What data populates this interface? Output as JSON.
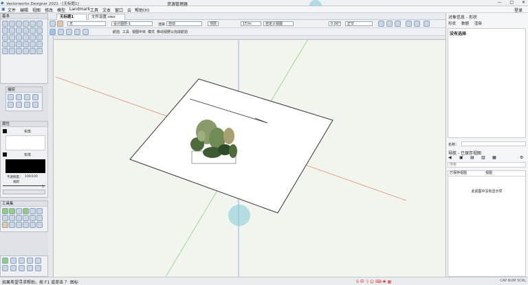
{
  "window": {
    "title": "Vectorworks Designer 2021 - [无标题1]",
    "center_title": "资源管理器",
    "controls": [
      "—",
      "□",
      "✕"
    ]
  },
  "menu": [
    "文件",
    "编辑",
    "视图",
    "修改",
    "模型",
    "Landmark",
    "工具",
    "文本",
    "窗口",
    "云",
    "帮助(H)"
  ],
  "menu_right": "登录",
  "tabs": [
    {
      "label": "无标题1",
      "close": "×"
    },
    {
      "label": "文件设置.vwx",
      "close": "×"
    }
  ],
  "toolbar": {
    "class_value": "无",
    "layer_value": "设计图层-1",
    "render_label": "渲染",
    "render_value": "自动",
    "projection_label": "投影",
    "plane_value": "顶层",
    "angle_value": "0.00°",
    "view_value": "正交",
    "unit_value": "1T/m",
    "scale_value": "自定义视图"
  },
  "breadcrumb": [
    "航拍",
    "工具",
    "视图中央",
    "模式",
    "移动视野以完成航拍"
  ],
  "left": {
    "basic_title": "基本",
    "tool_sets_title": "工具集",
    "snap_title": "捕捉",
    "attr": {
      "title": "属性",
      "fill_label": "实体",
      "pen_label": "实体",
      "opacity_label": "不透明度：",
      "opacity_value": "100/100",
      "layer_label": "规则",
      "line_value": "1"
    }
  },
  "right": {
    "obj_title": "对象信息 - 形状",
    "obj_tabs": [
      "形状",
      "数据",
      "渲染"
    ],
    "no_selection": "没有选择",
    "name_label": "名称：",
    "nav_title": "导航 - 已保存视图",
    "search_placeholder": "搜索",
    "col1": "已保存视图",
    "col2": "视图",
    "empty_msg": "此视图中没有显示项"
  },
  "status": {
    "message": "如果希望寻求帮助，按 F1 或单击 ？ 图标",
    "ime": "S 中 ·) ☺ ⌨ ✱ ▦",
    "keys": "CAP NUM SCRL"
  },
  "colors": {
    "axis_x": "#e07a5f",
    "axis_y": "#6fcf6f",
    "axis_z": "#7d8fe0",
    "canvas_bg": "#f1f5ee"
  }
}
